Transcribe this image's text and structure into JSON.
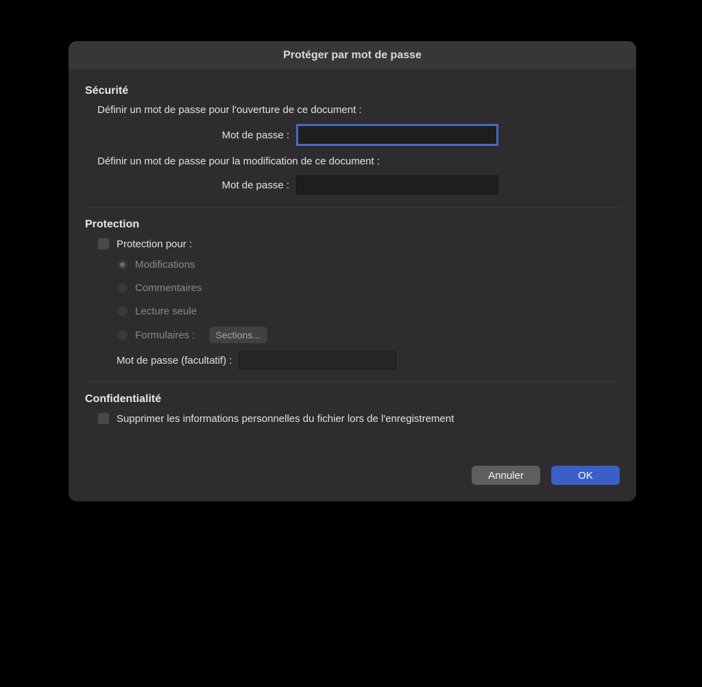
{
  "title": "Protéger par mot de passe",
  "security": {
    "heading": "Sécurité",
    "open_desc": "Définir un mot de passe pour l'ouverture de ce document :",
    "password_label": "Mot de passe :",
    "modify_desc": "Définir un mot de passe pour la modification de ce document :"
  },
  "protection": {
    "heading": "Protection",
    "protection_for": "Protection pour :",
    "options": {
      "modifications": "Modifications",
      "comments": "Commentaires",
      "readonly": "Lecture seule",
      "forms": "Formulaires :"
    },
    "sections_button": "Sections...",
    "optional_password": "Mot de passe (facultatif) :"
  },
  "privacy": {
    "heading": "Confidentialité",
    "remove_personal": "Supprimer les informations personnelles du fichier lors de l'enregistrement"
  },
  "buttons": {
    "cancel": "Annuler",
    "ok": "OK"
  }
}
